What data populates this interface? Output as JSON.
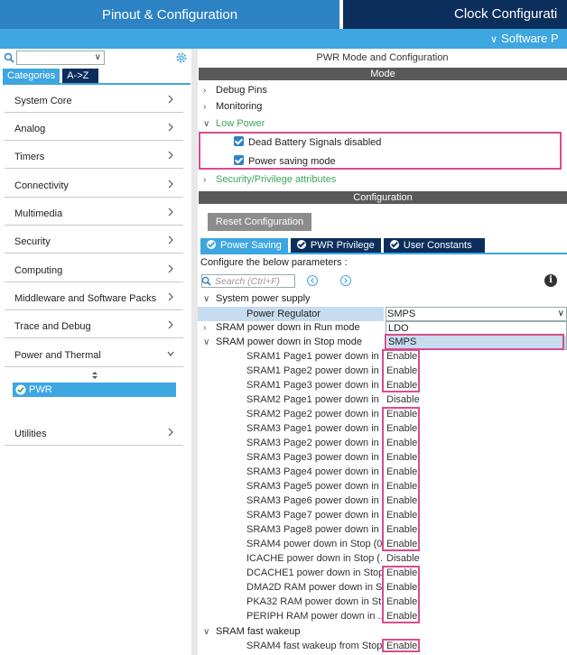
{
  "header": {
    "pinout_tab": "Pinout & Configuration",
    "clock_tab": "Clock Configurati",
    "software_packs": "Software P"
  },
  "left": {
    "category_tab": "Categories",
    "az_tab": "A->Z",
    "categories": [
      "System Core",
      "Analog",
      "Timers",
      "Connectivity",
      "Multimedia",
      "Security",
      "Computing",
      "Middleware and Software Packs",
      "Trace and Debug",
      "Power and Thermal"
    ],
    "selected_item": "PWR",
    "utilities": "Utilities"
  },
  "right": {
    "title": "PWR Mode and Configuration",
    "mode_header": "Mode",
    "mode_tree": {
      "debug_pins": "Debug Pins",
      "monitoring": "Monitoring",
      "low_power": "Low Power",
      "dead_battery": "Dead Battery Signals disabled",
      "power_saving": "Power saving mode",
      "security": "Security/Privilege attributes"
    },
    "config_header": "Configuration",
    "reset_button": "Reset Configuration",
    "tabs": [
      "Power Saving",
      "PWR Privilege",
      "User Constants"
    ],
    "configure_label": "Configure the below parameters :",
    "search_placeholder": "Search (Ctrl+F)",
    "system_power_supply": "System power supply",
    "power_regulator": "Power Regulator",
    "power_regulator_value": "SMPS",
    "dropdown_options": [
      "LDO",
      "SMPS"
    ],
    "sram_run": "SRAM power down in Run mode",
    "sram_stop": "SRAM power down in Stop mode",
    "params": [
      {
        "name": "SRAM1 Page1 power down in ...",
        "value": "Enable"
      },
      {
        "name": "SRAM1 Page2 power down in ...",
        "value": "Enable"
      },
      {
        "name": "SRAM1 Page3 power down in ...",
        "value": "Enable"
      },
      {
        "name": "SRAM2 Page1 power down in ...",
        "value": "Disable"
      },
      {
        "name": "SRAM2 Page2 power down in ...",
        "value": "Enable"
      },
      {
        "name": "SRAM3 Page1 power down in ...",
        "value": "Enable"
      },
      {
        "name": "SRAM3 Page2 power down in ...",
        "value": "Enable"
      },
      {
        "name": "SRAM3 Page3 power down in ...",
        "value": "Enable"
      },
      {
        "name": "SRAM3 Page4 power down in ...",
        "value": "Enable"
      },
      {
        "name": "SRAM3 Page5 power down in ...",
        "value": "Enable"
      },
      {
        "name": "SRAM3 Page6 power down in ...",
        "value": "Enable"
      },
      {
        "name": "SRAM3 Page7 power down in ...",
        "value": "Enable"
      },
      {
        "name": "SRAM3 Page8 power down in ...",
        "value": "Enable"
      },
      {
        "name": "SRAM4 power down in Stop (0...",
        "value": "Enable"
      },
      {
        "name": "ICACHE power down in Stop (...",
        "value": "Disable"
      },
      {
        "name": "DCACHE1 power down in Stop...",
        "value": "Enable"
      },
      {
        "name": "DMA2D RAM power down in S...",
        "value": "Enable"
      },
      {
        "name": "PKA32 RAM power down in St...",
        "value": "Enable"
      },
      {
        "name": "PERIPH RAM power down in ...",
        "value": "Enable"
      }
    ],
    "sram_fast": "SRAM fast wakeup",
    "fast_param": {
      "name": "SRAM4 fast wakeup from Stop...",
      "value": "Enable"
    }
  },
  "colors": {
    "accent": "#3ea6e0",
    "header_blue": "#2d82c4",
    "navy": "#0c2e5c",
    "highlight": "#d94c8e",
    "green": "#3da55a"
  }
}
